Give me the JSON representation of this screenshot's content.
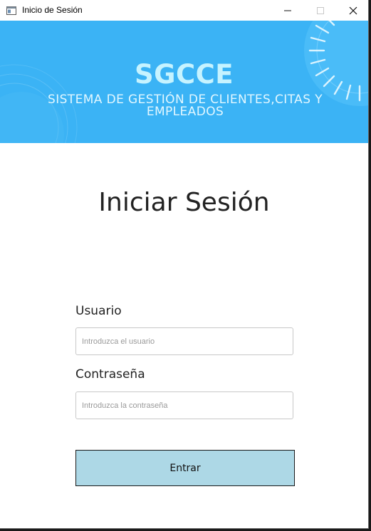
{
  "window": {
    "title": "Inicio de Sesión",
    "icon": "app-window-icon",
    "controls": [
      "minimize-icon",
      "maximize-icon",
      "close-icon"
    ]
  },
  "banner": {
    "logo": "SGCCE",
    "subtitle_line1": "SISTEMA DE GESTIÓN DE CLIENTES,CITAS Y",
    "subtitle_line2": "EMPLEADOS",
    "background_color": "#3bb3f5",
    "logo_color": "#c6f3ff"
  },
  "form": {
    "heading": "Iniciar Sesión",
    "user_label": "Usuario",
    "user_placeholder": "Introduzca el usuario",
    "user_value": "",
    "password_label": "Contraseña",
    "password_placeholder": "Introduzca la contraseña",
    "password_value": "",
    "submit_label": "Entrar",
    "submit_color": "#add8e6"
  }
}
